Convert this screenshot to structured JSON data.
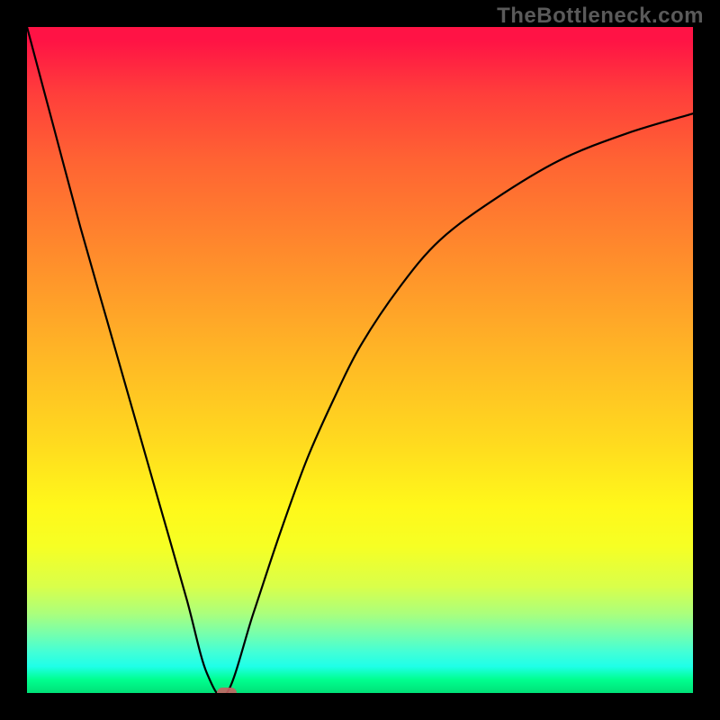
{
  "watermark": "TheBottleneck.com",
  "chart_data": {
    "type": "line",
    "title": "",
    "xlabel": "",
    "ylabel": "",
    "xlim": [
      0,
      100
    ],
    "ylim": [
      0,
      100
    ],
    "grid": false,
    "legend": false,
    "background_gradient": {
      "top": "#ff1345",
      "middle": "#ffd91f",
      "bottom": "#00e077"
    },
    "series": [
      {
        "name": "bottleneck-curve",
        "x": [
          0,
          4,
          8,
          12,
          16,
          20,
          24,
          27,
          30,
          34,
          38,
          42,
          46,
          50,
          56,
          62,
          70,
          80,
          90,
          100
        ],
        "y": [
          100,
          85,
          70,
          56,
          42,
          28,
          14,
          3,
          0,
          12,
          24,
          35,
          44,
          52,
          61,
          68,
          74,
          80,
          84,
          87
        ]
      }
    ],
    "min_point": {
      "x": 30,
      "y": 0,
      "color": "#c56262"
    }
  }
}
